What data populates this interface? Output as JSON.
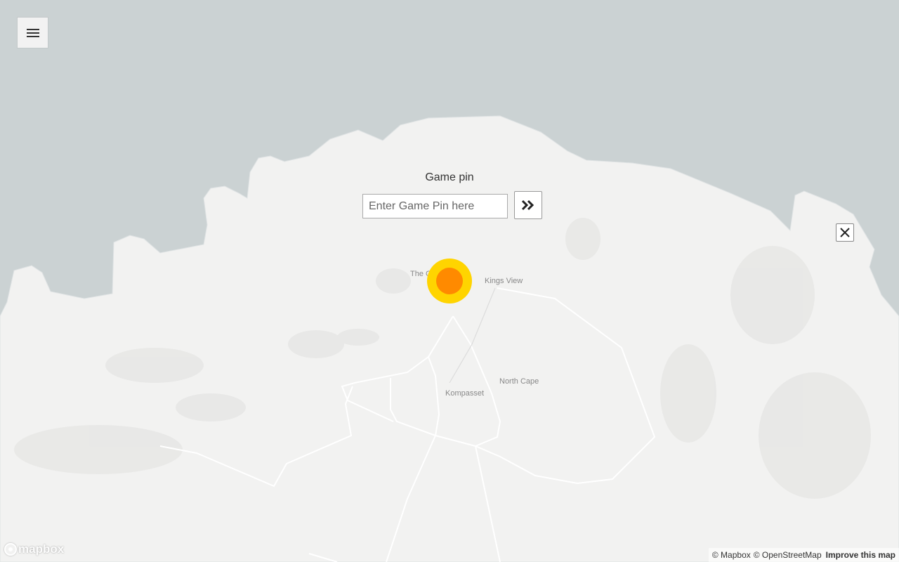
{
  "menu": {
    "icon": "hamburger-menu-icon"
  },
  "game_pin": {
    "title": "Game pin",
    "placeholder": "Enter Game Pin here",
    "value": "",
    "submit_icon": "double-chevron-right-icon"
  },
  "close": {
    "icon": "close-icon"
  },
  "map": {
    "labels": {
      "the_c": "The C",
      "kings_view": "Kings View",
      "north_cape": "North Cape",
      "kompasset": "Kompasset"
    },
    "colors": {
      "water": "#cbd2d3",
      "land": "#f2f2f1",
      "marker_outer": "#ffd400",
      "marker_inner": "#ff8a00"
    }
  },
  "mapbox_logo": {
    "text": "mapbox"
  },
  "attribution": {
    "mapbox": "© Mapbox",
    "osm": "© OpenStreetMap",
    "improve": "Improve this map"
  }
}
